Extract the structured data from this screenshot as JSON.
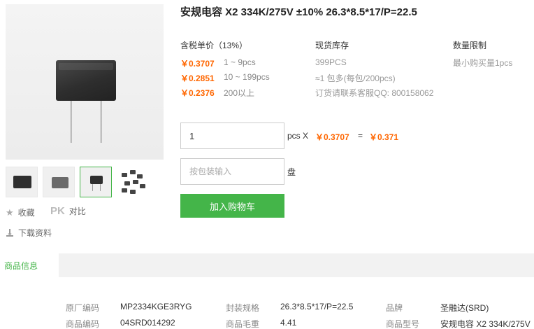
{
  "product": {
    "title": "安规电容 X2 334K/275V ±10% 26.3*8.5*17/P=22.5"
  },
  "pricing": {
    "header": "含税单价（13%）",
    "tiers": [
      {
        "price": "￥0.3707",
        "range": "1 ~ 9pcs"
      },
      {
        "price": "￥0.2851",
        "range": "10 ~ 199pcs"
      },
      {
        "price": "￥0.2376",
        "range": "200以上"
      }
    ]
  },
  "stock": {
    "header": "现货库存",
    "qty": "399PCS",
    "pack": "≈1 包多(每包/200pcs)",
    "contact": "订货请联系客服QQ: 800158062"
  },
  "limit": {
    "header": "数量限制",
    "min": "最小购买量1pcs"
  },
  "order": {
    "qty_value": "1",
    "unit_label": "pcs X",
    "unit_price": "￥0.3707",
    "equals": "=",
    "total": "￥0.371",
    "pack_placeholder": "按包装输入",
    "pack_unit": "盘",
    "add_to_cart": "加入购物车"
  },
  "tools": {
    "favorite": "收藏",
    "compare_pk": "PK",
    "compare": "对比",
    "download": "下载资料"
  },
  "tabs": {
    "info": "商品信息"
  },
  "specs": [
    {
      "key": "原厂编码",
      "value": "MP2334KGE3RYG"
    },
    {
      "key": "封装规格",
      "value": "26.3*8.5*17/P=22.5"
    },
    {
      "key": "品牌",
      "value": "圣融达(SRD)"
    },
    {
      "key": "商品编码",
      "value": "04SRD014292"
    },
    {
      "key": "商品毛重",
      "value": "4.41"
    },
    {
      "key": "商品型号",
      "value": "安规电容 X2 334K/275V"
    }
  ],
  "colors": {
    "accent": "#44b549",
    "price": "#ff6600"
  }
}
